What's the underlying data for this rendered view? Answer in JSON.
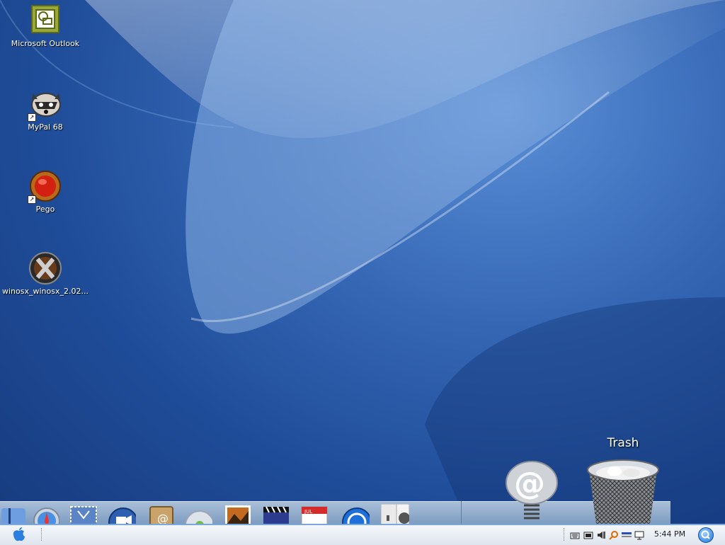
{
  "desktop": {
    "icons": [
      {
        "label": "Microsoft Outlook",
        "icon": "outlook-icon"
      },
      {
        "label": "MyPal 68",
        "icon": "raccoon-icon"
      },
      {
        "label": "Pego",
        "icon": "red-orb-icon"
      },
      {
        "label": "winosx_winosx_2.02...",
        "icon": "x-logo-icon"
      }
    ]
  },
  "dock": {
    "trash_label": "Trash",
    "items": [
      "finder-icon",
      "safari-icon",
      "mail-stamp-icon",
      "ichat-icon",
      "address-book-icon",
      "itunes-icon",
      "photo-icon",
      "movie-icon",
      "ical-icon",
      "web-icon",
      "system-prefs-icon",
      "mail-at-icon",
      "trash-icon"
    ]
  },
  "taskbar": {
    "start_icon": "apple-logo-icon",
    "clock": "5:44 PM",
    "tray": [
      "keyboard-icon",
      "battery-icon",
      "volume-icon",
      "search-tray-icon",
      "network-icon",
      "monitor-icon"
    ],
    "search_icon": "spotlight-search-icon"
  },
  "colors": {
    "taskbar_accent": "#7aa7e0",
    "desktop_blue": "#3567b5"
  }
}
